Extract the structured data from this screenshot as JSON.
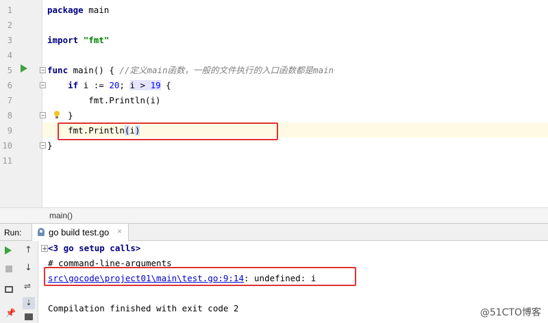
{
  "editor": {
    "line_numbers": [
      "1",
      "2",
      "3",
      "4",
      "5",
      "6",
      "7",
      "8",
      "9",
      "10",
      "11"
    ],
    "lines": {
      "l1": {
        "keyword": "package",
        "rest": " main"
      },
      "l3": {
        "keyword": "import",
        "string": "\"fmt\""
      },
      "l5": {
        "keyword": "func",
        "head": " main() { ",
        "comment_a": "//定义",
        "comment_b": "main",
        "comment_c": "函数，一般的文件执行的入口函数都是",
        "comment_d": "main"
      },
      "l6": {
        "indent": "    ",
        "keyword": "if",
        "part_a": " i := ",
        "num_a": "20",
        "part_b": "; ",
        "hl_a": "i > ",
        "num_b": "19",
        "part_c": " {"
      },
      "l7": {
        "code": "        fmt.Println(i)"
      },
      "l8": {
        "code": "    }"
      },
      "l9": {
        "code_a": "    fmt.Println",
        "ref_a": "(",
        "code_b": "i",
        "ref_b": ")"
      },
      "l10": {
        "code": "}"
      }
    }
  },
  "breadcrumb": {
    "text": "main()"
  },
  "run_panel": {
    "label": "Run:",
    "tab_label": "go build test.go",
    "tab_close": "×",
    "console": {
      "setup_calls": "<3 go setup calls>",
      "line_args": "# command-line-arguments",
      "error_link": "src\\gocode\\project01\\main\\test.go:9:14",
      "error_message": ": undefined: i",
      "finished": "Compilation finished with exit code 2"
    }
  },
  "icons": {
    "up": "↑",
    "down": "↓",
    "wrap": "⇌",
    "sort": "⇣",
    "pin": "📌"
  },
  "watermark": "@51CTO博客",
  "colors": {
    "keyword": "#000080",
    "string": "#008000",
    "number": "#0000ff",
    "comment": "#808080",
    "error_box": "#e03030",
    "run_green": "#3ca23c"
  }
}
